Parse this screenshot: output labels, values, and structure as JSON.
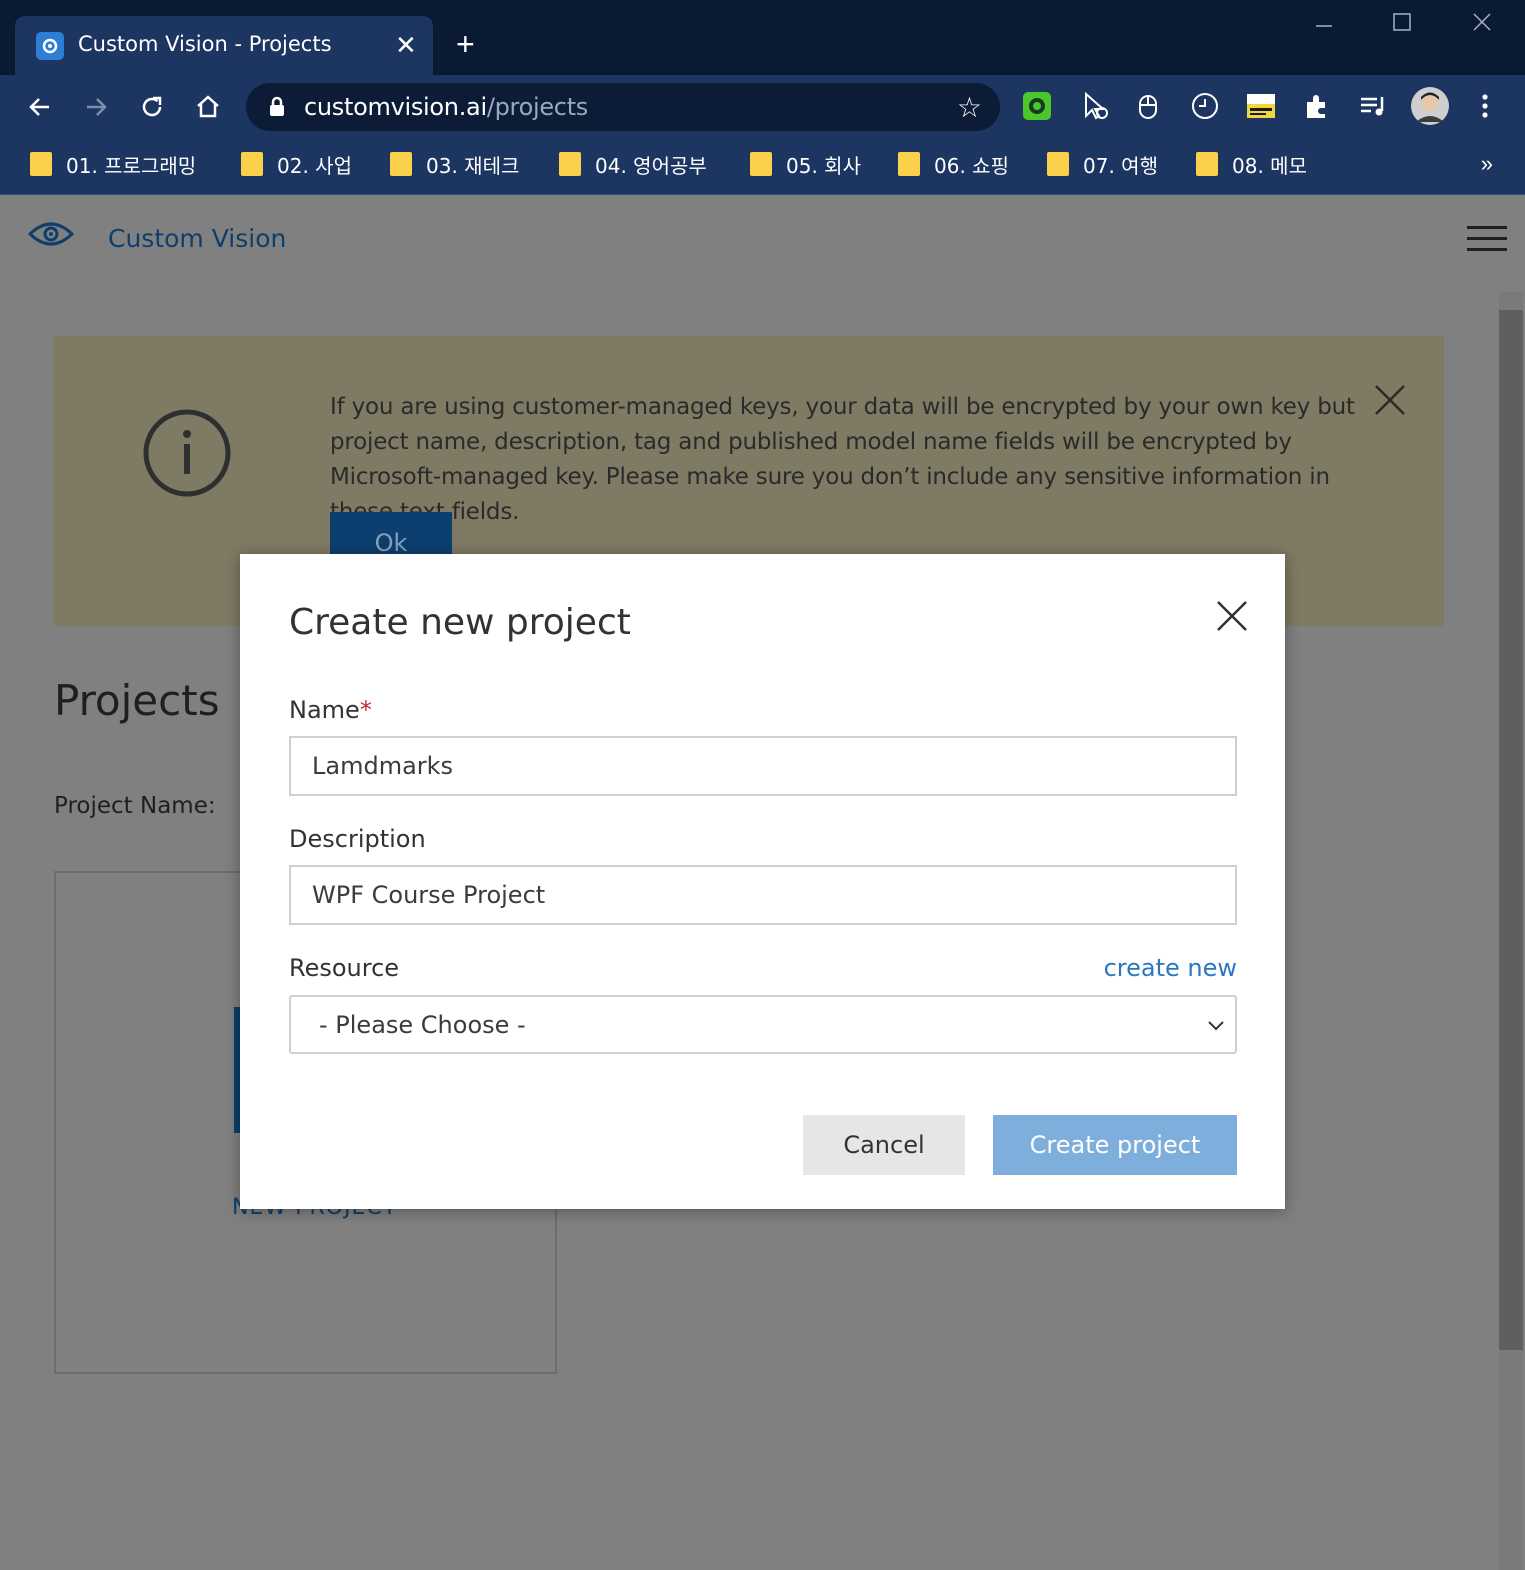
{
  "browser": {
    "tab_title": "Custom Vision - Projects",
    "close_tab_glyph": "✕",
    "new_tab_glyph": "+",
    "url_host": "customvision.ai",
    "url_path": "/projects",
    "bookmarks": [
      {
        "label": "01. 프로그래밍"
      },
      {
        "label": "02. 사업"
      },
      {
        "label": "03. 재테크"
      },
      {
        "label": "04. 영어공부"
      },
      {
        "label": "05. 회사"
      },
      {
        "label": "06. 쇼핑"
      },
      {
        "label": "07. 여행"
      },
      {
        "label": "08. 메모"
      }
    ],
    "bookmarks_more": "»",
    "icons": {
      "back": "arrow-left-icon",
      "forward": "arrow-right-icon",
      "reload": "reload-icon",
      "home": "home-icon",
      "lock": "lock-icon",
      "bookmark_star": "star-icon",
      "extensions": "puzzle-icon",
      "media": "playlist-icon",
      "menu": "kebab-icon"
    },
    "folder_color": "#fbd04a"
  },
  "app": {
    "brand": "Custom Vision",
    "banner": {
      "text": "If you are using customer-managed keys, your data will be encrypted by your own key but project name, description, tag and published model name fields will be encrypted by Microsoft-managed key. Please make sure you don’t include any sensitive information in these text fields.",
      "ok_label": "Ok"
    },
    "projects_title": "Projects",
    "project_name_label": "Project Name:",
    "new_project_label": "NEW PROJECT"
  },
  "modal": {
    "title": "Create new project",
    "name_label": "Name",
    "required_mark": "*",
    "name_value": "Lamdmarks",
    "description_label": "Description",
    "description_value": "WPF Course Project",
    "resource_label": "Resource",
    "create_new_link": "create new",
    "resource_selected": "- Please Choose -",
    "cancel_label": "Cancel",
    "create_label": "Create project"
  },
  "colors": {
    "chrome_dark": "#0b1a33",
    "chrome": "#1c3561",
    "brand_blue": "#0e3e6b",
    "link_blue": "#2a78c2",
    "primary_disabled": "#7eaedc"
  }
}
